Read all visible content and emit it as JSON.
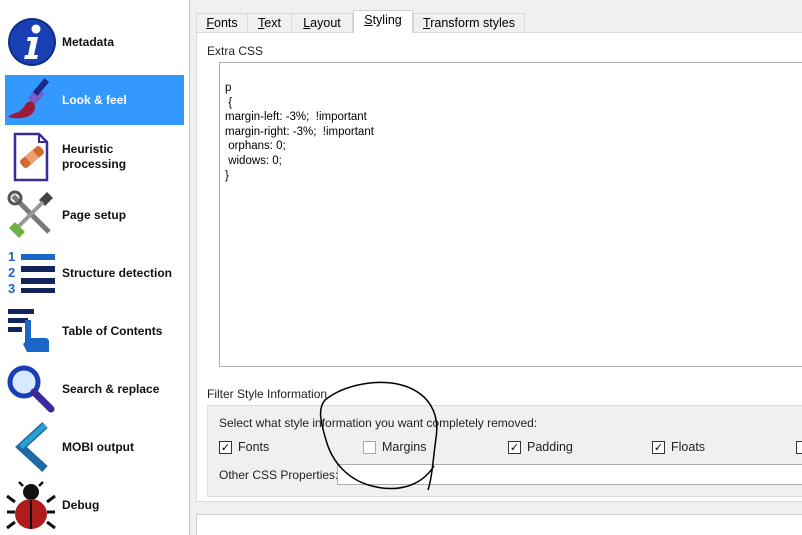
{
  "sidebar": {
    "items": [
      {
        "label": "Metadata",
        "icon": "info-icon",
        "selected": false
      },
      {
        "label": "Look & feel",
        "icon": "paintbrush-icon",
        "selected": true
      },
      {
        "label": "Heuristic processing",
        "icon": "bandaid-document-icon",
        "selected": false
      },
      {
        "label": "Page setup",
        "icon": "tools-icon",
        "selected": false
      },
      {
        "label": "Structure detection",
        "icon": "numbered-list-icon",
        "selected": false
      },
      {
        "label": "Table of Contents",
        "icon": "toc-pointer-icon",
        "selected": false
      },
      {
        "label": "Search & replace",
        "icon": "magnifier-icon",
        "selected": false
      },
      {
        "label": "MOBI output",
        "icon": "chevron-left-icon",
        "selected": false
      },
      {
        "label": "Debug",
        "icon": "bug-icon",
        "selected": false
      }
    ]
  },
  "tabs": [
    {
      "label": "Fonts",
      "mnemonic": "F",
      "rest": "onts"
    },
    {
      "label": "Text",
      "mnemonic": "T",
      "rest": "ext"
    },
    {
      "label": "Layout",
      "mnemonic": "L",
      "rest": "ayout"
    },
    {
      "label": "Styling",
      "mnemonic": "S",
      "rest": "tyling"
    },
    {
      "label": "Transform styles",
      "mnemonic": "T",
      "rest": "ransform styles"
    }
  ],
  "active_tab": "Styling",
  "extra_css": {
    "title": "Extra CSS",
    "lines": [
      "p",
      " {",
      "margin-left: -3%;  !important",
      "margin-right: -3%;  !important",
      " orphans: 0;",
      " widows: 0;",
      "}"
    ]
  },
  "filter": {
    "title": "Filter Style Information",
    "description": "Select what style information you want completely removed:",
    "options": [
      {
        "label": "Fonts",
        "checked": true
      },
      {
        "label": "Margins",
        "checked": false
      },
      {
        "label": "Padding",
        "checked": true
      },
      {
        "label": "Floats",
        "checked": true
      }
    ],
    "other_label": "Other CSS Properties:",
    "other_value": ""
  },
  "colors": {
    "selection": "#3399ff",
    "scribble": "#000000"
  }
}
